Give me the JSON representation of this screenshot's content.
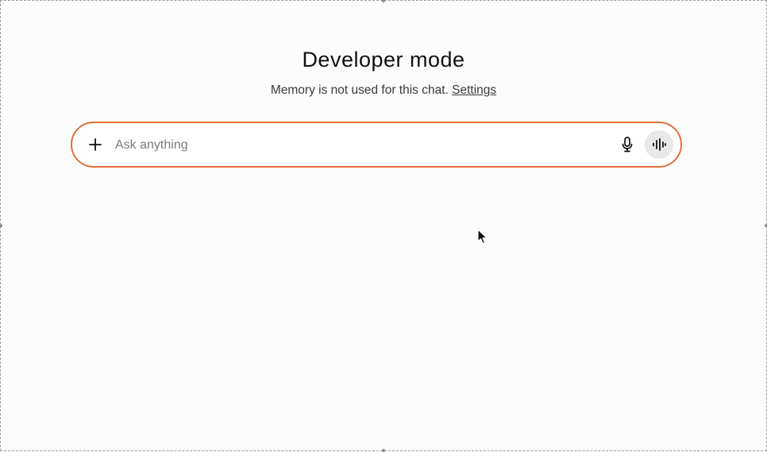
{
  "header": {
    "title": "Developer mode",
    "subtitle_text": "Memory is not used for this chat. ",
    "settings_link": "Settings"
  },
  "composer": {
    "placeholder": "Ask anything",
    "value": "",
    "accent_color": "#e0703a",
    "icons": {
      "add": "plus-icon",
      "dictate": "microphone-icon",
      "voice": "voice-waveform-icon"
    }
  }
}
